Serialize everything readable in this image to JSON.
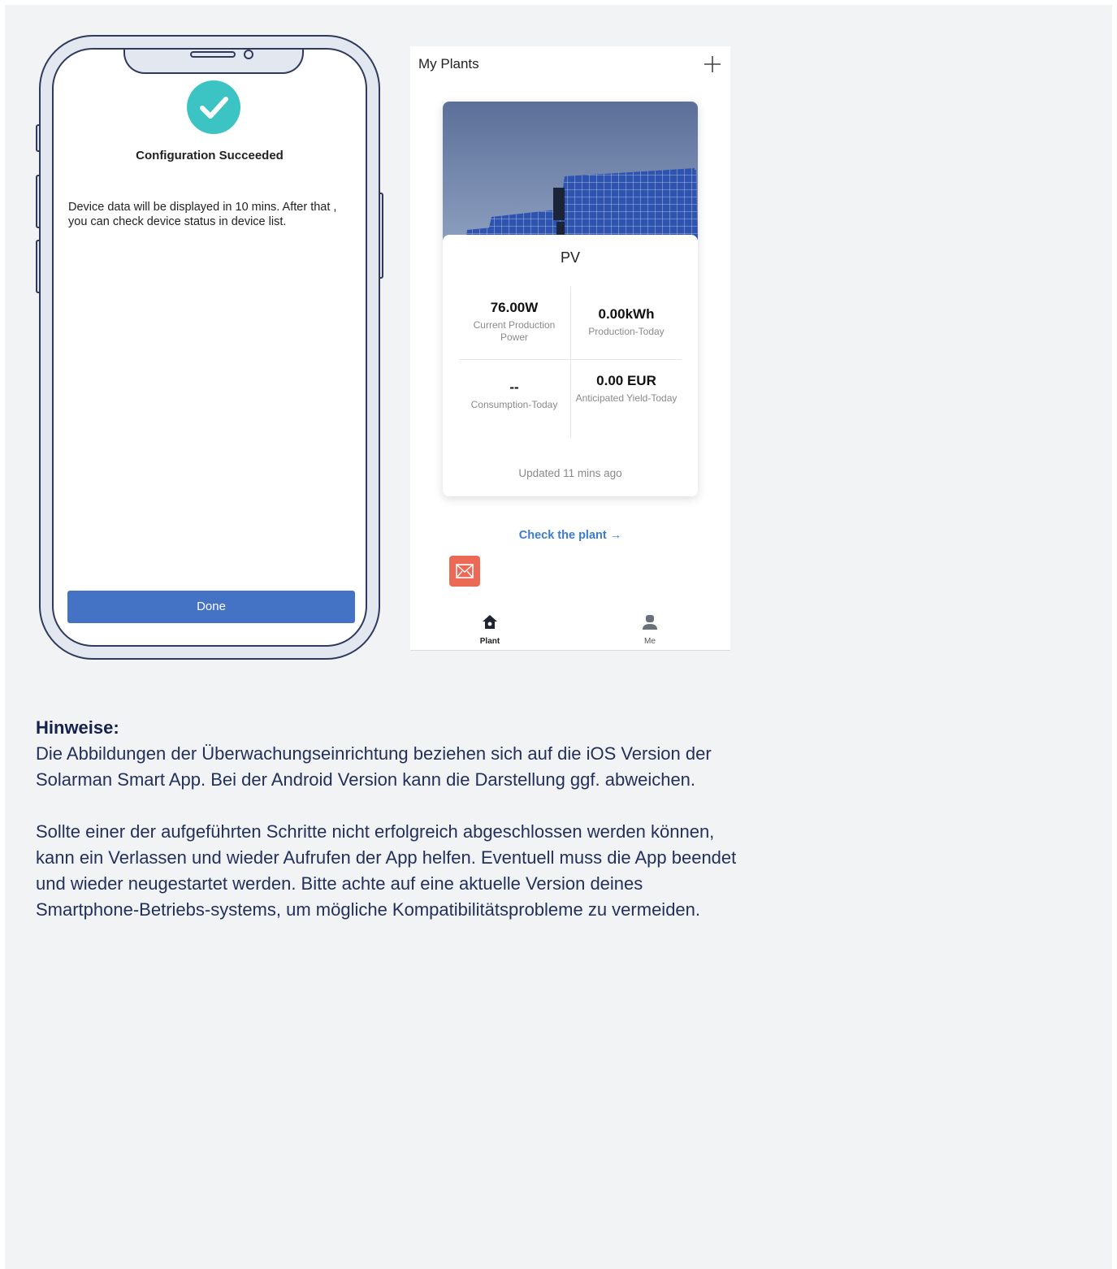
{
  "phone_config": {
    "title": "Configuration Succeeded",
    "message": "Device data will be displayed in 10 mins. After that , you can check device status in device list.",
    "done_label": "Done"
  },
  "app": {
    "title": "My Plants",
    "card": {
      "plant_name": "PV",
      "current_power_value": "76.00W",
      "current_power_label": "Current Production Power",
      "production_today_value": "0.00kWh",
      "production_today_label": "Production-Today",
      "consumption_today_value": "--",
      "consumption_today_label": "Consumption-Today",
      "yield_today_value": "0.00 EUR",
      "yield_today_label": "Anticipated Yield-Today",
      "updated": "Updated 11 mins ago"
    },
    "check_plant": "Check the plant →",
    "tabs": [
      {
        "label": "Plant",
        "icon": "home-icon"
      },
      {
        "label": "Me",
        "icon": "user-icon"
      }
    ],
    "colors": {
      "link": "#3b7bd6",
      "mail_badge": "#ec6a55",
      "done_button": "#4472c4",
      "success": "#3cc4c4"
    }
  },
  "notes": {
    "heading": "Hinweise:",
    "paragraph_1": "Die Abbildungen der Überwachungseinrichtung beziehen sich auf die iOS Version der Solarman Smart App. Bei der Android Version kann die Darstellung ggf. abweichen.",
    "paragraph_2": "Sollte einer der aufgeführten Schritte nicht erfolgreich abgeschlossen werden können, kann ein Verlassen und wieder Aufrufen der App helfen. Eventuell muss die App beendet und wieder neugestartet werden. Bitte achte auf eine aktuelle Version deines Smartphone-Betriebs-systems, um mögliche Kompatibilitätsprobleme zu vermeiden."
  }
}
